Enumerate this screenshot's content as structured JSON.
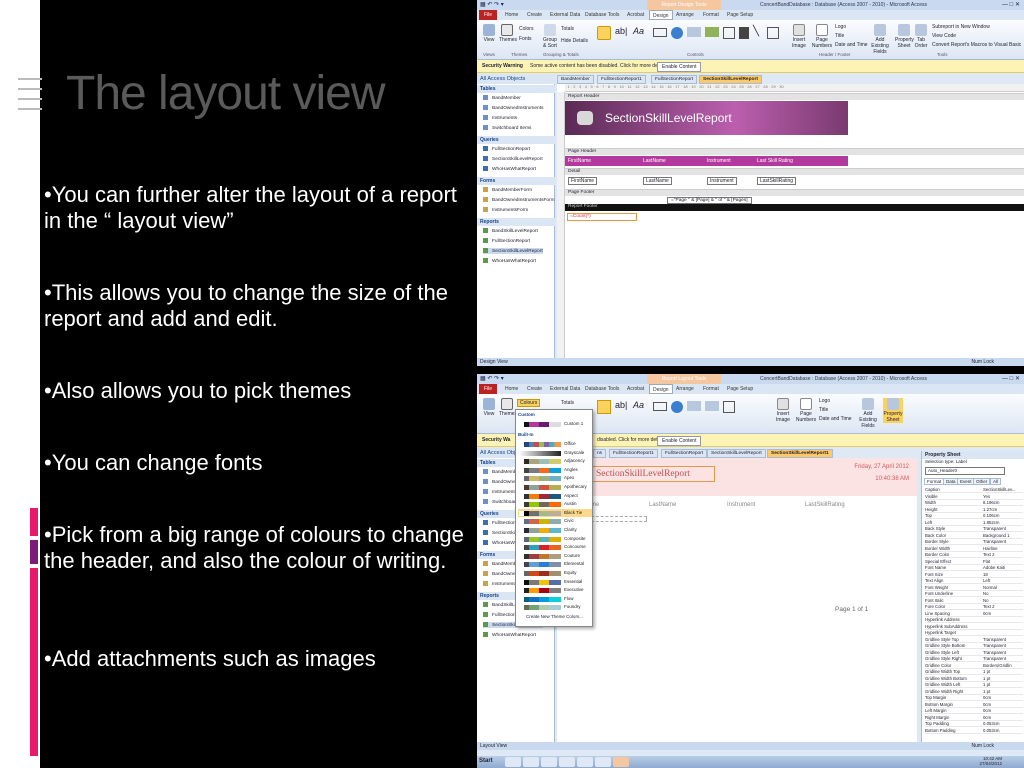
{
  "slide": {
    "title": "The layout view",
    "bullets": [
      "•You can further alter the layout of a report in the “ layout view”",
      "•This allows you to change the size of the report and add and edit.",
      "•Also allows you to pick themes",
      "•You can change fonts",
      "•Pick from a big range of colours to change the header, and also the colour of writing.",
      "•Add attachments such as images"
    ]
  },
  "colors": {
    "magenta": "#b3399f",
    "accent_red": "#b22",
    "bar_pink": "#e8196a",
    "bar_purple": "#7a1d7a"
  },
  "shot1": {
    "window_title": "ConcertBandDatabase : Database (Access 2007 - 2010) - Microsoft Access",
    "context_tab": "Report Design Tools",
    "tabs": [
      "File",
      "Home",
      "Create",
      "External Data",
      "Database Tools",
      "Acrobat",
      "Design",
      "Arrange",
      "Format",
      "Page Setup"
    ],
    "ribbon": {
      "buttons": [
        "View",
        "Themes",
        "Colors",
        "Fonts",
        "Group & Sort",
        "Totals",
        "Hide Details",
        "Insert Image",
        "Page Numbers",
        "Logo",
        "Title",
        "Date and Time",
        "Add Existing Fields",
        "Property Sheet",
        "Tab Order"
      ],
      "tools_links": [
        "Subreport in New Window",
        "View Code",
        "Convert Report's Macros to Visual Basic"
      ],
      "groups": [
        "Views",
        "Themes",
        "Grouping & Totals",
        "Controls",
        "Header / Footer",
        "Tools"
      ]
    },
    "security": {
      "label": "Security Warning",
      "message": "Some active content has been disabled. Click for more details.",
      "button": "Enable Content"
    },
    "nav": {
      "header": "All Access Objects",
      "categories": [
        {
          "name": "Tables",
          "items": [
            "BandMember",
            "BandOwnedInstruments",
            "Instruments",
            "Switchboard Items"
          ]
        },
        {
          "name": "Queries",
          "items": [
            "FullSectionReport",
            "SectionSkillLevelReport",
            "WhoHasWhatReport"
          ]
        },
        {
          "name": "Forms",
          "items": [
            "BandMemberForm",
            "BandOwnedInstrumentsForm",
            "InstrumentsForm"
          ]
        },
        {
          "name": "Reports",
          "items": [
            "BandSkillLevelReport",
            "FullSectionReport",
            "SectionSkillLevelReport",
            "WhoHasWhatReport"
          ]
        }
      ]
    },
    "doc_tabs": [
      "BandMember",
      "FullSectionReport1",
      "FullSectionReport",
      "SectionSkillLevelReport"
    ],
    "design": {
      "report_header": "Report Header",
      "report_title": "SectionSkillLevelReport",
      "page_header": "Page Header",
      "columns": [
        "FirstName",
        "LastName",
        "Instrument",
        "Last Skill Rating"
      ],
      "detail": "Detail",
      "detail_fields": [
        "FirstName",
        "LastName",
        "Instrument",
        "LastSkillRating"
      ],
      "page_footer": "Page Footer",
      "page_expr": "=\"Page \" & [Page] & \" of \" & [Pages]",
      "report_footer": "Report Footer",
      "count_expr": "=Count(*)"
    },
    "status": {
      "left": "Design View",
      "right": "Num Lock"
    }
  },
  "shot2": {
    "window_title": "ConcertBandDatabase : Database (Access 2007 - 2010) - Microsoft Access",
    "context_tab": "Report Layout Tools",
    "colours_button": "Colours",
    "dropdown": {
      "custom_label": "Custom",
      "custom_item": "Custom 1",
      "builtin_label": "Built-In",
      "themes": [
        "Office",
        "Grayscale",
        "Adjacency",
        "Angles",
        "Apex",
        "Apothecary",
        "Aspect",
        "Austin",
        "Black Tie",
        "Civic",
        "Clarity",
        "Composite",
        "Concourse",
        "Couture",
        "Elemental",
        "Equity",
        "Essential",
        "Executive",
        "Flow",
        "Foundry"
      ],
      "selected": "Black Tie",
      "create": "Create New Theme Colors..."
    },
    "security": {
      "label": "Security Wa",
      "message": "disabled. Click for more details.",
      "button": "Enable Content"
    },
    "doc_tabs": [
      "ns",
      "FullSectionReport1",
      "FullSectionReport",
      "SectionSkillLevelReport",
      "SectionSkillLevelReport1"
    ],
    "report": {
      "title": "SectionSkillLevelReport",
      "date": "Friday, 27 April 2012",
      "time": "10:40:38 AM",
      "columns": [
        "me",
        "LastName",
        "Instrument",
        "LastSkillRating"
      ],
      "page": "Page 1 of 1"
    },
    "property_sheet": {
      "title": "Property Sheet",
      "selection": "Selection type: Label",
      "combo": "Auto_Header0",
      "tabs": [
        "Format",
        "Data",
        "Event",
        "Other",
        "All"
      ],
      "rows": [
        [
          "Caption",
          "SectionSkillLev..."
        ],
        [
          "Visible",
          "Yes"
        ],
        [
          "Width",
          "8.196cm"
        ],
        [
          "Height",
          "1.27cm"
        ],
        [
          "Top",
          "0.106cm"
        ],
        [
          "Left",
          "1.852cm"
        ],
        [
          "Back Style",
          "Transparent"
        ],
        [
          "Back Color",
          "Background 1"
        ],
        [
          "Border Style",
          "Transparent"
        ],
        [
          "Border Width",
          "Hairline"
        ],
        [
          "Border Color",
          "Text 2"
        ],
        [
          "Special Effect",
          "Flat"
        ],
        [
          "Font Name",
          "Adobe Kaiti"
        ],
        [
          "Font Size",
          "18"
        ],
        [
          "Text Align",
          "Left"
        ],
        [
          "Font Weight",
          "Normal"
        ],
        [
          "Font Underline",
          "No"
        ],
        [
          "Font Italic",
          "No"
        ],
        [
          "Fore Color",
          "Text 2"
        ],
        [
          "Line Spacing",
          "0cm"
        ],
        [
          "Hyperlink Address",
          ""
        ],
        [
          "Hyperlink SubAddress",
          ""
        ],
        [
          "Hyperlink Target",
          ""
        ],
        [
          "Gridline Style Top",
          "Transparent"
        ],
        [
          "Gridline Style Bottom",
          "Transparent"
        ],
        [
          "Gridline Style Left",
          "Transparent"
        ],
        [
          "Gridline Style Right",
          "Transparent"
        ],
        [
          "Gridline Color",
          "Borders/Gridlin"
        ],
        [
          "Gridline Width Top",
          "1 pt"
        ],
        [
          "Gridline Width Bottom",
          "1 pt"
        ],
        [
          "Gridline Width Left",
          "1 pt"
        ],
        [
          "Gridline Width Right",
          "1 pt"
        ],
        [
          "Top Margin",
          "0cm"
        ],
        [
          "Bottom Margin",
          "0cm"
        ],
        [
          "Left Margin",
          "0cm"
        ],
        [
          "Right Margin",
          "0cm"
        ],
        [
          "Top Padding",
          "0.053cm"
        ],
        [
          "Bottom Padding",
          "0.053cm"
        ]
      ]
    },
    "status": {
      "left": "Layout View",
      "right": "Num Lock"
    },
    "taskbar": {
      "start": "Start",
      "time": "10:42 AM",
      "date": "27/04/2012"
    }
  }
}
